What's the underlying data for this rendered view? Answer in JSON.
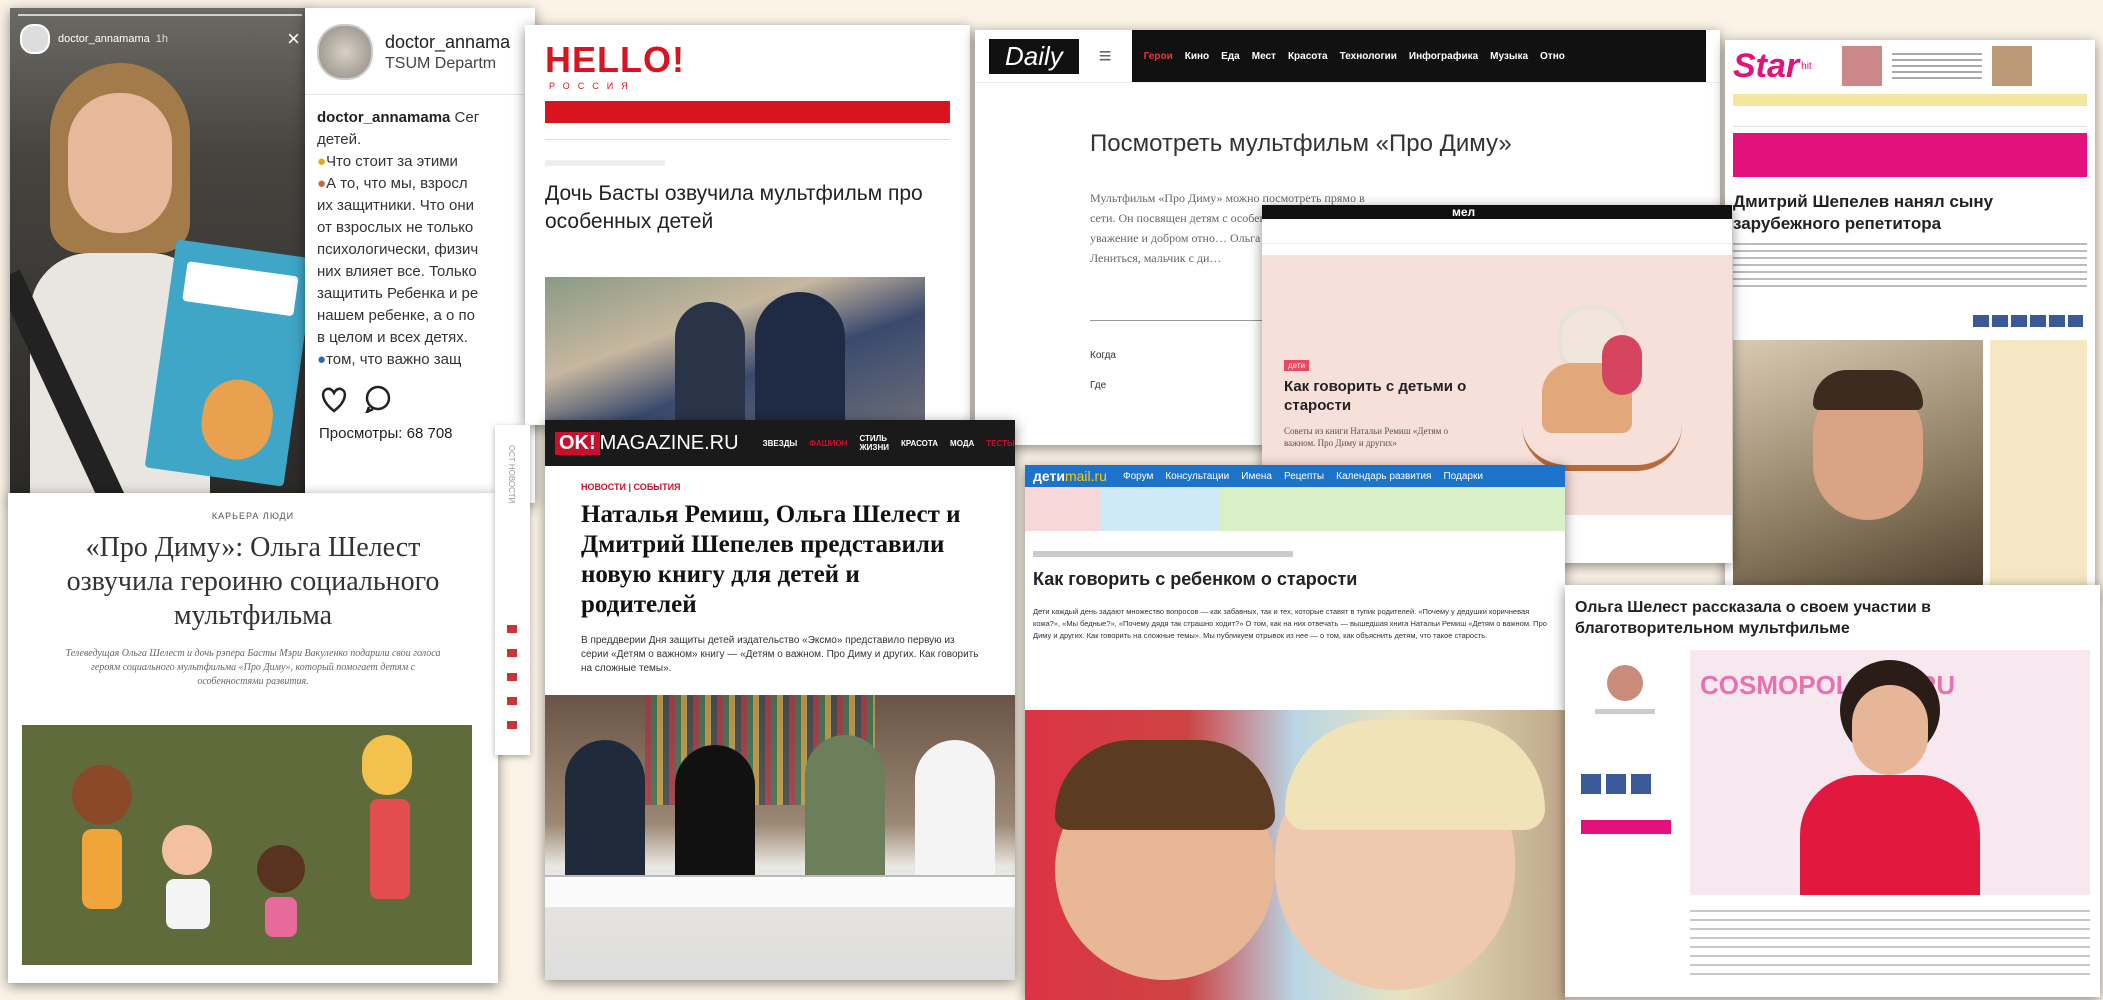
{
  "insta_story": {
    "username": "doctor_annamama",
    "age": "1h",
    "close": "×"
  },
  "insta_post": {
    "username": "doctor_annama",
    "location": "TSUM Departm",
    "caption_user": "doctor_annamama",
    "caption_lines": [
      "Сег",
      "детей.",
      "Что стоит за этими",
      "А то, что мы, взросл",
      "их защитники. Что они",
      "от взрослых не только",
      "психологически, физич",
      "них влияет все. Только",
      "защитить Ребенка и ре",
      "нашем ребенке, а о по",
      "в целом и всех детях.",
      "том, что важно защ"
    ],
    "views": "Просмотры: 68 708"
  },
  "hello": {
    "logo": "HELLO!",
    "sub": "РОССИЯ",
    "headline": "Дочь Басты озвучила мультфильм про особенных детей"
  },
  "daily": {
    "logo": "Daily",
    "nav": [
      "Герои",
      "Кино",
      "Еда",
      "Мест",
      "Красота",
      "Технологии",
      "Инфографика",
      "Музыка",
      "Отно"
    ],
    "headline": "Посмотреть мультфильм «Про Диму»",
    "body": "Мультфильм «Про Диму» можно посмотреть прямо в сети. Он посвящен детям с особенностями развития… уважение и добром отно… Ольга Шелест и дочка р… Лениться, мальчик с ди…",
    "label1": "Когда",
    "label2": "Где"
  },
  "star": {
    "logo": "Star",
    "logo_sub": "hit",
    "headline": "Дмитрий Шепелев нанял сыну зарубежного репетитора"
  },
  "mel": {
    "logo": "мел",
    "tag": "дети",
    "headline": "Как говорить с детьми о старости",
    "sub": "Советы из книги Натальи Ремиш «Детям о важном. Про Диму и других»"
  },
  "left_article": {
    "rubric": "КАРЬЕРА ЛЮДИ",
    "headline": "«Про Диму»: Ольга Шелест озвучила героиню социального мультфильма",
    "lede": "Телеведущая Ольга Шелест и дочь рэпера Басты Мэри Вакуленко подарили свои голоса героям социального мультфильма «Про Диму», который помогает детям с особенностями развития.",
    "side_label": "ОСТ НОВОСТИ"
  },
  "ok": {
    "logo": "OK!",
    "logo_rest": "MAGAZINE.RU",
    "nav": [
      "ЗВЕЗДЫ",
      "ФАШИОН",
      "СТИЛЬ ЖИЗНИ",
      "КРАСОТА",
      "МОДА",
      "ТЕСТЫ"
    ],
    "rubric": "НОВОСТИ | СОБЫТИЯ",
    "headline": "Наталья Ремиш, Ольга Шелест и Дмитрий Шепелев представили новую книгу для детей и родителей",
    "body": "В преддверии Дня защиты детей издательство «Эксмо» представило первую из серии «Детям о важном» книгу — «Детям о важном. Про Диму и других. Как говорить на сложные темы»."
  },
  "deti": {
    "logo": "дети",
    "logo_rest": "mail.ru",
    "nav": [
      "Форум",
      "Консультации",
      "Имена",
      "Рецепты",
      "Календарь развития",
      "Подарки"
    ],
    "headline": "Как говорить с ребенком о старости",
    "body": "Дети каждый день задают множество вопросов — как забавных, так и тех, которые ставят в тупик родителей. «Почему у дедушки коричневая кожа?», «Мы бедные?», «Почему дядя так страшно ходит?» О том, как на них отвечать — вышедшая книга Натальи Ремиш «Детям о важном. Про Диму и других. Как говорить на сложные темы». Мы публикуем отрывок из нее — о том, как объяснить детям, что такое старость."
  },
  "cosmo": {
    "headline": "Ольга Шелест рассказала о своем участии в благотворительном мультфильме",
    "wall_text": "COSMOPOLITAN.RU"
  },
  "colors": {
    "hello_red": "#d8141f",
    "ok_red": "#c8102e",
    "mail_blue": "#1d73c9",
    "star_pink": "#e2117c",
    "daily_black": "#111111"
  }
}
